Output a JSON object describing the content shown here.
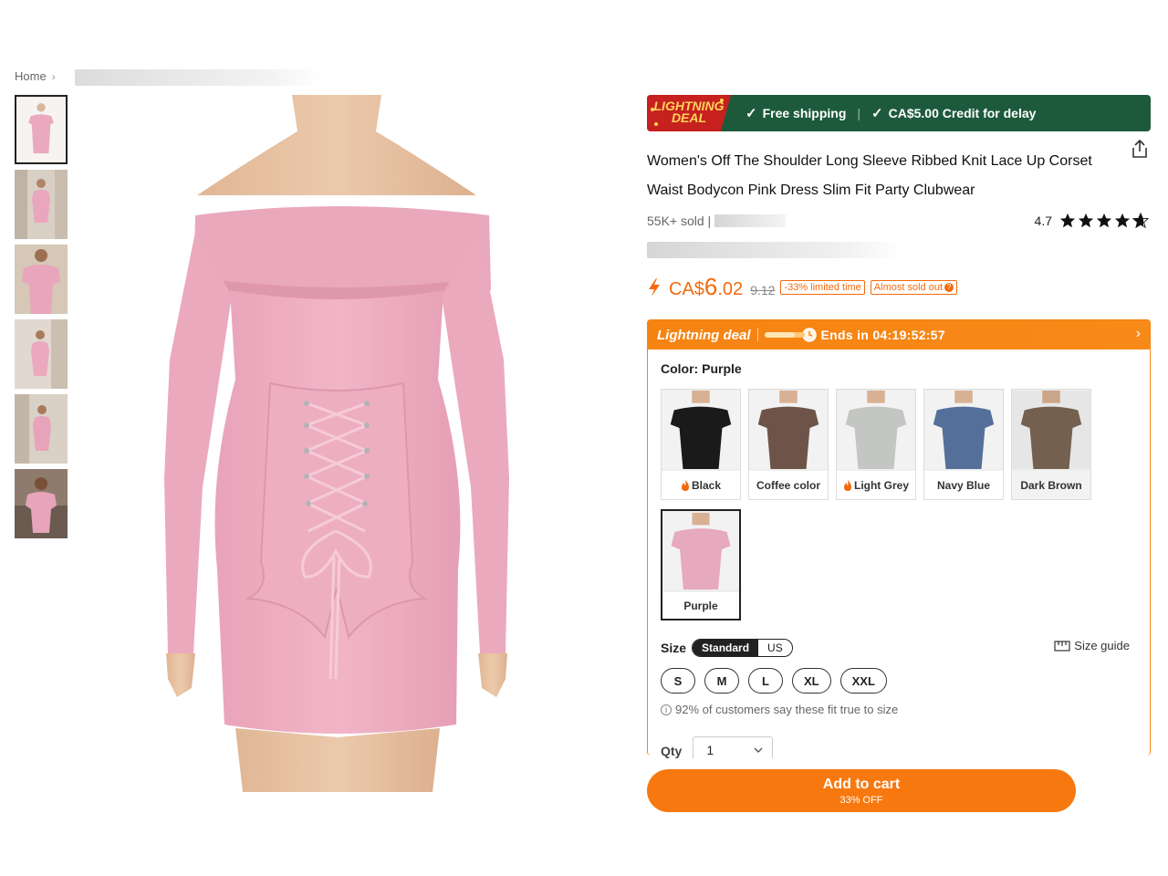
{
  "breadcrumb": {
    "home": "Home",
    "separator": "›"
  },
  "product": {
    "title": "Women's Off The Shoulder Long Sleeve Ribbed Knit Lace Up Corset Waist Bodycon Pink Dress Slim Fit Party Clubwear",
    "sold": "55K+ sold |",
    "rating": "4.7",
    "rating_value": 4.7
  },
  "banner": {
    "badge_line1": "LIGHTNING",
    "badge_line2": "DEAL",
    "shipping": "Free shipping",
    "separator": "|",
    "credit": "CA$5.00 Credit for delay",
    "check_icon": "check-icon",
    "bg_color": "#1d5a3c",
    "badge_color": "#c6211e"
  },
  "price": {
    "currency": "CA$",
    "whole": "6",
    "cents": ".02",
    "old": "9.12",
    "discount_tag": "-33% limited time",
    "stock_tag": "Almost sold out",
    "color": "#f26a0e"
  },
  "lightning_deal": {
    "label": "Lightning deal",
    "ends": "Ends in 04:19:52:57",
    "progress": 0.75,
    "chevron": "›"
  },
  "color": {
    "label": "Color: Purple",
    "options": [
      {
        "name": "Black",
        "hot": true,
        "fill": "#1a1a1a",
        "dim": false
      },
      {
        "name": "Coffee color",
        "hot": false,
        "fill": "#6e5448",
        "dim": false
      },
      {
        "name": "Light Grey",
        "hot": true,
        "fill": "#c3c6c2",
        "dim": false
      },
      {
        "name": "Navy Blue",
        "hot": false,
        "fill": "#54709a",
        "dim": false
      },
      {
        "name": "Dark Brown",
        "hot": false,
        "fill": "#74604f",
        "dim": true
      },
      {
        "name": "Purple",
        "hot": false,
        "fill": "#e7a9bd",
        "dim": false,
        "selected": true
      }
    ]
  },
  "size": {
    "label": "Size",
    "toggle": [
      "Standard",
      "US"
    ],
    "guide": "Size guide",
    "options": [
      "S",
      "M",
      "L",
      "XL",
      "XXL"
    ],
    "fit_note": "92% of customers say these fit true to size"
  },
  "qty": {
    "label": "Qty",
    "value": "1"
  },
  "cart": {
    "label": "Add to cart",
    "sub": "33% OFF",
    "color": "#f7780f"
  },
  "thumbnails": [
    "thumb-1",
    "thumb-2",
    "thumb-3",
    "thumb-4",
    "thumb-5",
    "thumb-6"
  ]
}
